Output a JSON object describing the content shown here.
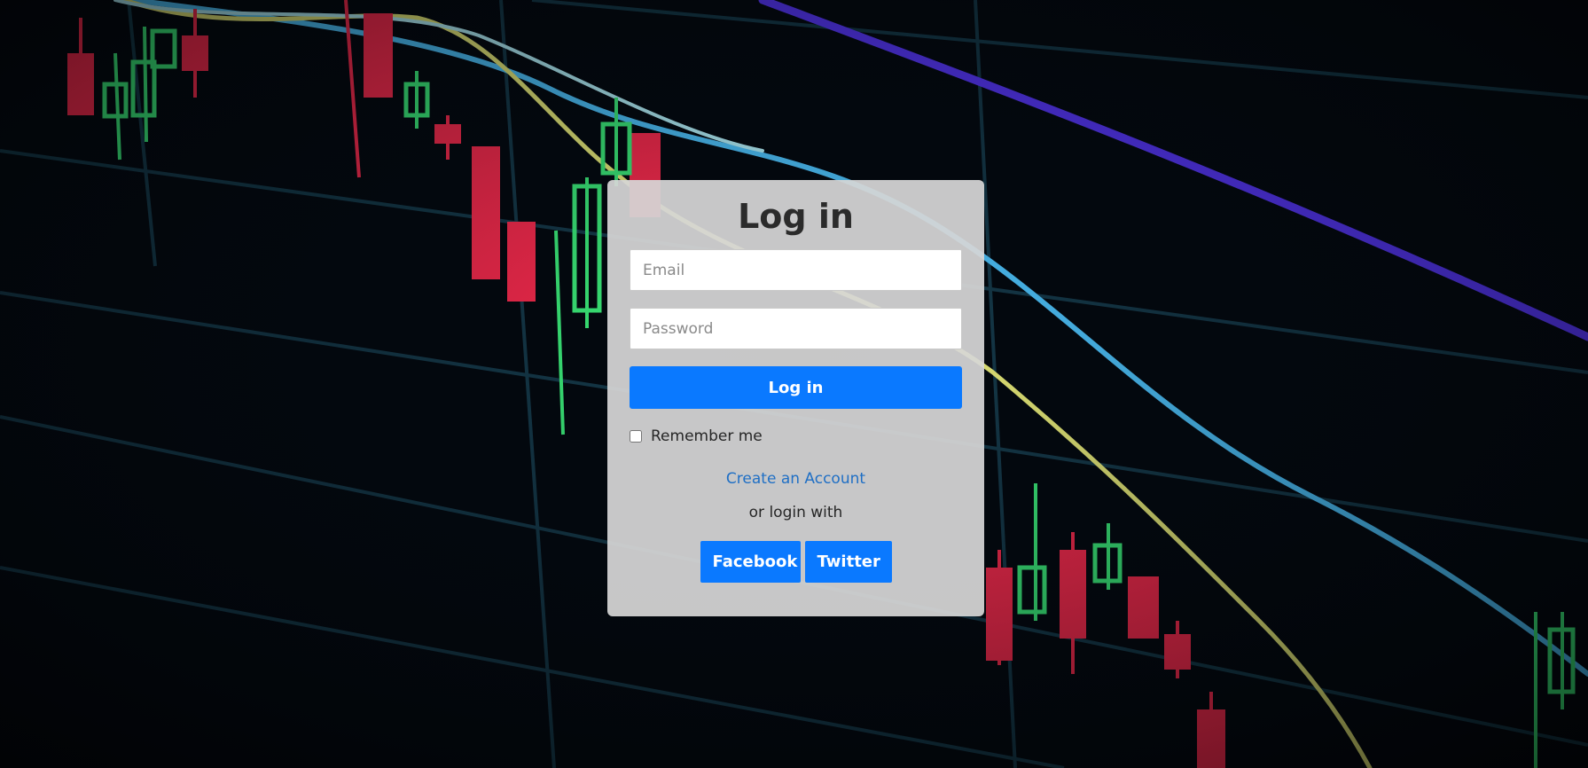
{
  "login": {
    "title": "Log in",
    "email_placeholder": "Email",
    "password_placeholder": "Password",
    "submit_label": "Log in",
    "remember_label": "Remember me",
    "remember_checked": false,
    "create_account_label": "Create an Account",
    "or_text": "or login with",
    "facebook_label": "Facebook",
    "twitter_label": "Twitter"
  },
  "theme": {
    "primary": "#0a79ff",
    "link": "#1f6fc5",
    "card_bg": "#d6d6d6",
    "page_bg": "#02040a"
  }
}
